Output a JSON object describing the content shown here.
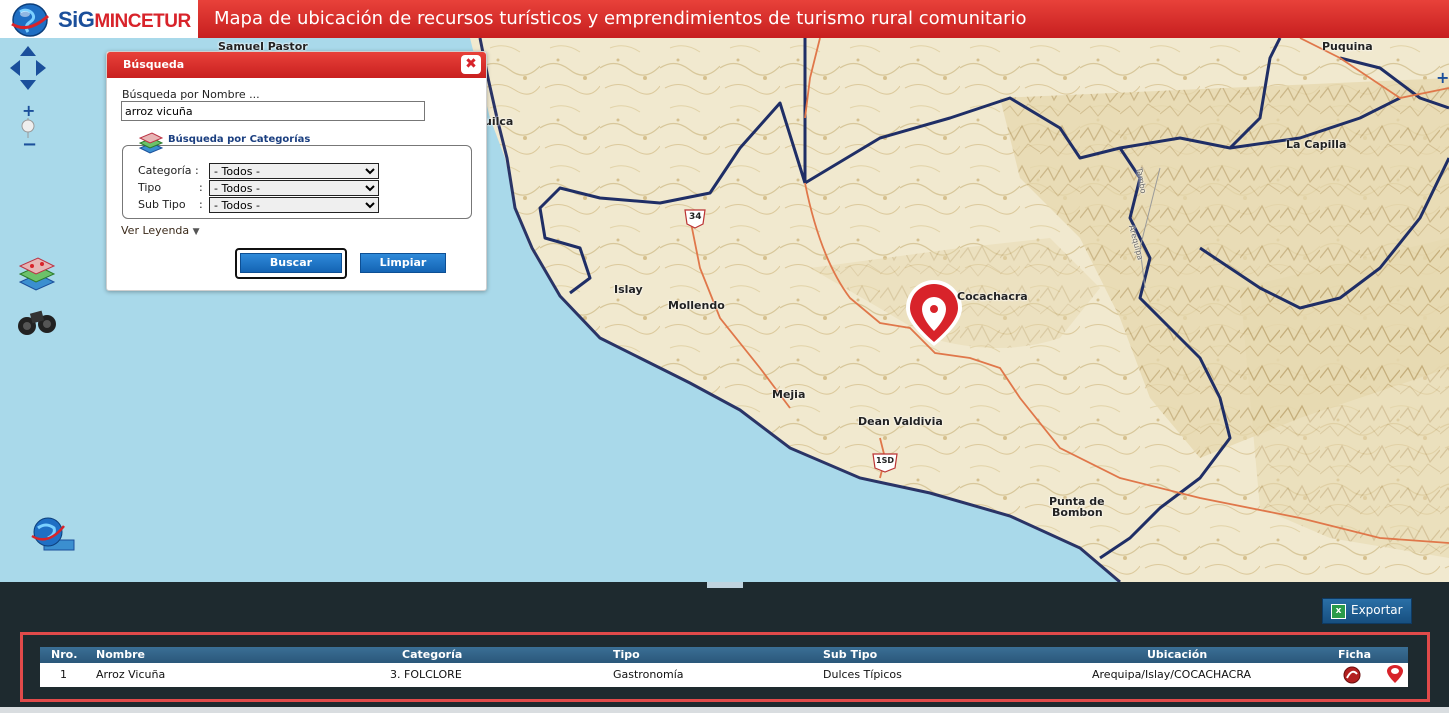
{
  "header": {
    "logo_sig": "SiG",
    "logo_mincetur": "MINCETUR",
    "title": "Mapa de ubicación de recursos turísticos y emprendimientos de turismo rural comunitario"
  },
  "map": {
    "labels": {
      "samuel_pastor": "Samuel Pastor",
      "quilca": "uilca",
      "islay": "Islay",
      "mollendo": "Mollendo",
      "mejia": "Mejia",
      "dean_valdivia": "Dean Valdivia",
      "cocachacra": "Cocachacra",
      "punta_de_bombon_line1": "Punta de",
      "punta_de_bombon_line2": "Bombon",
      "puquina": "Puquina",
      "la_capilla": "La Capilla",
      "road_34": "34",
      "road_1sd": "1SD",
      "river_1": "Arequipa",
      "river_2": "Tambo"
    },
    "icons": {
      "pan": "pan-arrows-icon",
      "zoom_in": "zoom-in-icon",
      "zoom_out": "zoom-out-icon",
      "layers": "layers-icon",
      "binoculars": "binoculars-icon",
      "globe": "globe-icon",
      "marker": "map-marker-icon"
    },
    "colors": {
      "sea": "#a9d9ea",
      "land": "#f3ecd6",
      "boundary": "#1f2e66",
      "road": "#e0774a",
      "marker": "#d8232a"
    }
  },
  "search_panel": {
    "title": "Búsqueda",
    "name_label": "Búsqueda por Nombre ...",
    "name_value": "arroz vicuña",
    "category_legend": "Búsqueda por Categorías",
    "categoria_label": "Categoría :",
    "tipo_label": "Tipo",
    "tipo_colon": ":",
    "subtipo_label": "Sub Tipo",
    "subtipo_colon": ":",
    "categoria_value": "- Todos -",
    "tipo_value": "- Todos -",
    "subtipo_value": "- Todos -",
    "legend_link": "Ver Leyenda",
    "search_button": "Buscar",
    "clear_button": "Limpiar"
  },
  "results": {
    "export_label": "Exportar",
    "columns": {
      "nro": "Nro.",
      "nombre": "Nombre",
      "categoria": "Categoría",
      "tipo": "Tipo",
      "subtipo": "Sub Tipo",
      "ubicacion": "Ubicación",
      "ficha": "Ficha"
    },
    "rows": [
      {
        "nro": "1",
        "nombre": "Arroz Vicuña",
        "categoria": "3. FOLCLORE",
        "tipo": "Gastronomía",
        "subtipo": "Dulces Típicos",
        "ubicacion": "Arequipa/Islay/COCACHACRA"
      }
    ]
  }
}
